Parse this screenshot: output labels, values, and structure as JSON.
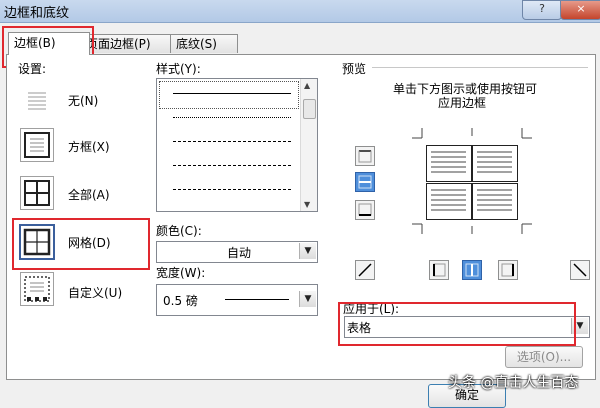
{
  "window": {
    "title": "边框和底纹",
    "help": "?",
    "close": "×"
  },
  "tabs": [
    {
      "label": "边框(B)"
    },
    {
      "label": "页面边框(P)"
    },
    {
      "label": "底纹(S)"
    }
  ],
  "settings": {
    "heading": "设置:",
    "items": [
      {
        "label": "无(N)"
      },
      {
        "label": "方框(X)"
      },
      {
        "label": "全部(A)"
      },
      {
        "label": "网格(D)"
      },
      {
        "label": "自定义(U)"
      }
    ],
    "selected": "网格(D)"
  },
  "style": {
    "heading": "样式(Y):"
  },
  "color": {
    "label": "颜色(C):",
    "value": "自动"
  },
  "width": {
    "label": "宽度(W):",
    "value": "0.5 磅"
  },
  "preview": {
    "heading": "预览",
    "hint_line1": "单击下方图示或使用按钮可",
    "hint_line2": "应用边框"
  },
  "apply": {
    "label": "应用于(L):",
    "value": "表格"
  },
  "buttons": {
    "options": "选项(O)...",
    "ok": "确定"
  },
  "watermark": "头条 @直击人生百态",
  "colors": {
    "highlight": "#e0282e",
    "accent": "#4f8fdb"
  }
}
